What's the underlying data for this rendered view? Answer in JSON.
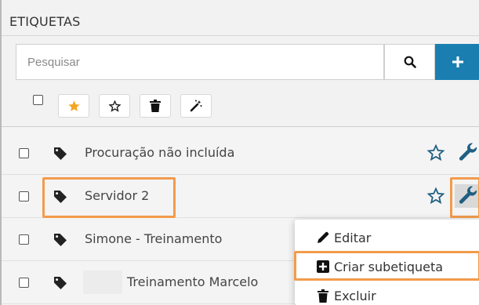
{
  "panel": {
    "title": "ETIQUETAS"
  },
  "search": {
    "placeholder": "Pesquisar",
    "value": ""
  },
  "toolbar": {
    "icons": [
      "star-filled-icon",
      "star-outline-icon",
      "trash-icon",
      "magic-wand-icon"
    ]
  },
  "tags": [
    {
      "label": "Procuração não incluída"
    },
    {
      "label": "Servidor 2"
    },
    {
      "label": "Simone - Treinamento"
    },
    {
      "label": "Treinamento Marcelo"
    }
  ],
  "context_menu": {
    "items": [
      {
        "label": "Editar",
        "icon": "pencil-icon"
      },
      {
        "label": "Criar subetiqueta",
        "icon": "plus-square-icon"
      },
      {
        "label": "Excluir",
        "icon": "trash-icon"
      }
    ]
  },
  "colors": {
    "accent": "#1a7fb0",
    "highlight": "#f29b4c",
    "star_filled": "#f5a623"
  }
}
